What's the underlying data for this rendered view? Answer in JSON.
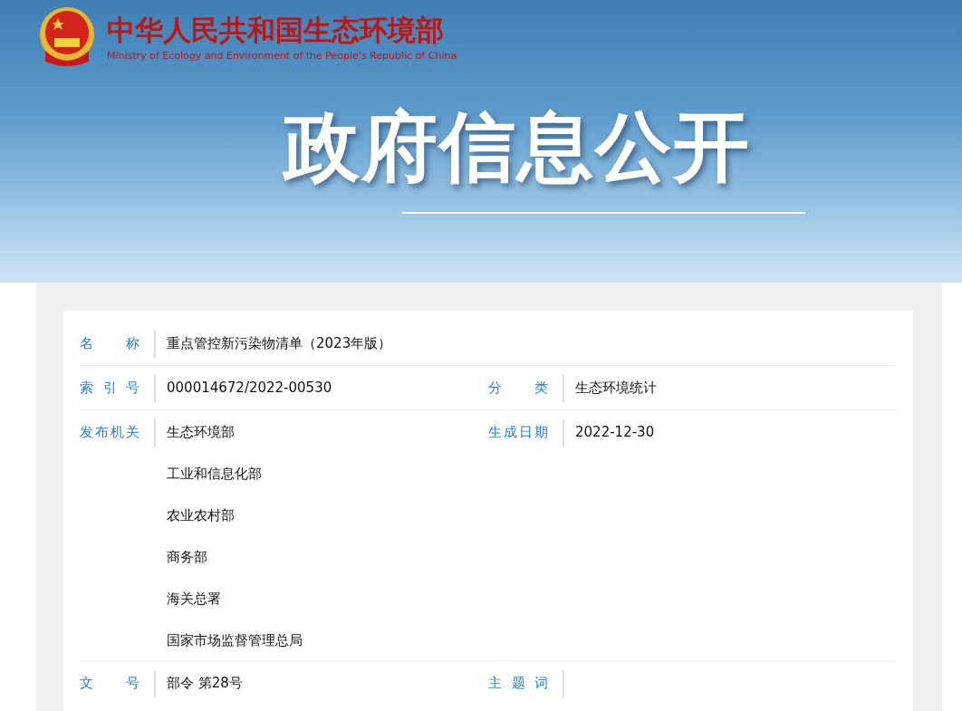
{
  "header": {
    "name_zh": "中华人民共和国生态环境部",
    "name_en": "Ministry of Ecology and Environment of the People's Republic of China"
  },
  "banner": {
    "title": "政府信息公开"
  },
  "info_rows": [
    {
      "fields": [
        {
          "label": "名称",
          "values": [
            "重点管控新污染物清单（2023年版）"
          ]
        }
      ]
    },
    {
      "fields": [
        {
          "label": "索引号",
          "values": [
            "000014672/2022-00530"
          ]
        },
        {
          "label": "分类",
          "values": [
            "生态环境统计"
          ]
        }
      ]
    },
    {
      "fields": [
        {
          "label": "发布机关",
          "values": [
            "生态环境部",
            "工业和信息化部",
            "农业农村部",
            "商务部",
            "海关总署",
            "国家市场监督管理总局"
          ]
        },
        {
          "label": "生成日期",
          "values": [
            "2022-12-30"
          ]
        }
      ]
    },
    {
      "fields": [
        {
          "label": "文号",
          "values": [
            "部令 第28号"
          ]
        },
        {
          "label": "主题词"
        }
      ]
    }
  ]
}
